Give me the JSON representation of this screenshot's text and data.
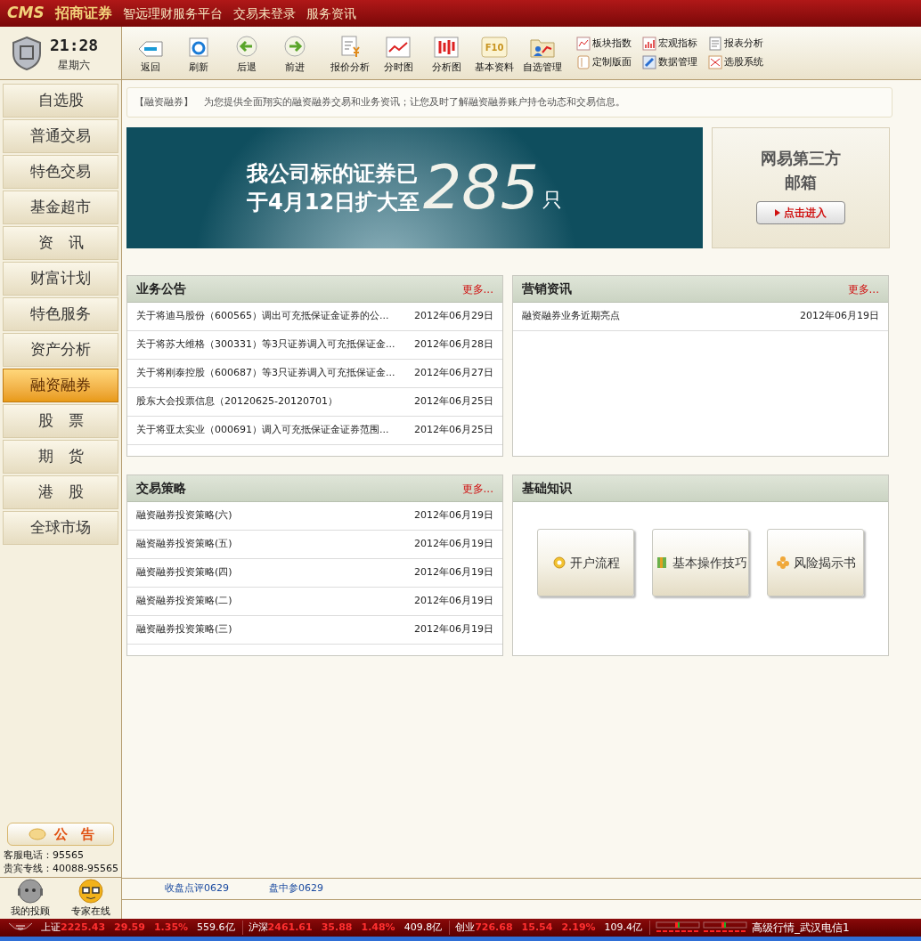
{
  "title_bar": {
    "brand": "CMS",
    "company": "招商证券",
    "items": [
      "智远理财服务平台",
      "交易未登录",
      "服务资讯"
    ]
  },
  "clock": {
    "time": "21:28",
    "weekday": "星期六"
  },
  "toolbar": {
    "buttons": [
      {
        "label": "返回",
        "kind": "back"
      },
      {
        "label": "刷新",
        "kind": "refresh"
      },
      {
        "label": "后退",
        "kind": "left"
      },
      {
        "label": "前进",
        "kind": "right"
      },
      {
        "label": "报价分析",
        "kind": "quote"
      },
      {
        "label": "分时图",
        "kind": "line"
      },
      {
        "label": "分析图",
        "kind": "candle"
      },
      {
        "label": "基本资料",
        "kind": "f10",
        "icon_text": "F10"
      },
      {
        "label": "自选管理",
        "kind": "folder"
      }
    ],
    "small_buttons": [
      {
        "label": "板块指数",
        "kind": "grid"
      },
      {
        "label": "宏观指标",
        "kind": "bars"
      },
      {
        "label": "报表分析",
        "kind": "doc"
      },
      {
        "label": "定制版面",
        "kind": "layout"
      },
      {
        "label": "数据管理",
        "kind": "tool"
      },
      {
        "label": "选股系统",
        "kind": "pick"
      }
    ]
  },
  "sidebar": {
    "items": [
      {
        "label": "自选股",
        "selected": false
      },
      {
        "label": "普通交易",
        "selected": false
      },
      {
        "label": "特色交易",
        "selected": false
      },
      {
        "label": "基金超市",
        "selected": false
      },
      {
        "label": "资　讯",
        "selected": false
      },
      {
        "label": "财富计划",
        "selected": false
      },
      {
        "label": "特色服务",
        "selected": false
      },
      {
        "label": "资产分析",
        "selected": false
      },
      {
        "label": "融资融券",
        "selected": true
      },
      {
        "label": "股　票",
        "selected": false
      },
      {
        "label": "期　货",
        "selected": false
      },
      {
        "label": "港　股",
        "selected": false
      },
      {
        "label": "全球市场",
        "selected": false
      }
    ],
    "notice_button": "公　告",
    "hotlines": [
      "客服电话：95565",
      "贵宾专线：40088-95565"
    ],
    "advisors": [
      {
        "label": "我的投顾",
        "kind": "robot"
      },
      {
        "label": "专家在线",
        "kind": "glasses"
      }
    ]
  },
  "intro": {
    "tag": "【融资融券】",
    "text": "为您提供全面翔实的融资融券交易和业务资讯；让您及时了解融资融券账户持仓动态和交易信息。"
  },
  "banner": {
    "line1": "我公司标的证券已",
    "line2": "于4月12日扩大至",
    "number": "285",
    "unit": "只"
  },
  "mail_card": {
    "lines": [
      "网易第三方",
      "邮箱"
    ],
    "button": "点击进入"
  },
  "panels": [
    {
      "title": "业务公告",
      "more": "更多...",
      "rows": [
        {
          "text": "关于将迪马股份（600565）调出可充抵保证金证券的公...",
          "date": "2012年06月29日"
        },
        {
          "text": "关于将苏大维格（300331）等3只证券调入可充抵保证金...",
          "date": "2012年06月28日"
        },
        {
          "text": "关于将刚泰控股（600687）等3只证券调入可充抵保证金...",
          "date": "2012年06月27日"
        },
        {
          "text": "股东大会投票信息（20120625-20120701）",
          "date": "2012年06月25日"
        },
        {
          "text": "关于将亚太实业（000691）调入可充抵保证金证券范围...",
          "date": "2012年06月25日"
        }
      ]
    },
    {
      "title": "营销资讯",
      "more": "更多...",
      "rows": [
        {
          "text": "融资融券业务近期亮点",
          "date": "2012年06月19日"
        }
      ]
    },
    {
      "title": "交易策略",
      "more": "更多...",
      "rows": [
        {
          "text": "融资融券投资策略(六)",
          "date": "2012年06月19日"
        },
        {
          "text": "融资融券投资策略(五)",
          "date": "2012年06月19日"
        },
        {
          "text": "融资融券投资策略(四)",
          "date": "2012年06月19日"
        },
        {
          "text": "融资融券投资策略(二)",
          "date": "2012年06月19日"
        },
        {
          "text": "融资融券投资策略(三)",
          "date": "2012年06月19日"
        }
      ]
    },
    {
      "title": "基础知识",
      "buttons": [
        {
          "label": "开户流程",
          "kind": "gear"
        },
        {
          "label": "基本操作技巧",
          "kind": "book"
        },
        {
          "label": "风险揭示书",
          "kind": "flower"
        }
      ]
    }
  ],
  "links": [
    "收盘点评0629",
    "盘中参0629"
  ],
  "status_bar": {
    "indices": [
      {
        "name": "上证",
        "value": "2225.43",
        "change": "29.59",
        "pct": "1.35%",
        "volume": "559.6亿"
      },
      {
        "name": "沪深",
        "value": "2461.61",
        "change": "35.88",
        "pct": "1.48%",
        "volume": "409.8亿"
      },
      {
        "name": "创业",
        "value": "726.68",
        "change": "15.54",
        "pct": "2.19%",
        "volume": "109.4亿"
      }
    ],
    "server": "高级行情_武汉电信1"
  }
}
